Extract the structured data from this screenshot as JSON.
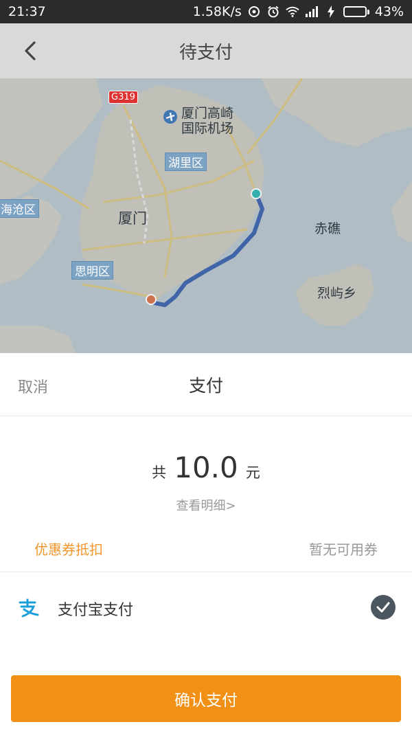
{
  "status_bar": {
    "time": "21:37",
    "network_speed": "1.58K/s",
    "battery_percent": "43%",
    "battery_level": 0.43,
    "icons": [
      "sync-icon",
      "alarm-icon",
      "wifi-icon",
      "signal-icon",
      "charging-icon",
      "battery-icon"
    ]
  },
  "header": {
    "title": "待支付",
    "back_icon": "chevron-left-icon"
  },
  "map": {
    "labels": {
      "road": "G319",
      "airport_1": "厦门高崎",
      "airport_2": "国际机场",
      "huli": "湖里区",
      "haicang": "海沧区",
      "xiamen": "厦门",
      "chijiao": "赤礁",
      "siming": "思明区",
      "lieyu": "烈屿乡"
    },
    "route_color": "#2f5aa8"
  },
  "sheet": {
    "cancel_label": "取消",
    "title": "支付",
    "amount_prefix": "共",
    "amount_value": "10.0",
    "amount_suffix": "元",
    "detail_link": "查看明细>",
    "coupon_label": "优惠券抵扣",
    "coupon_value": "暂无可用券",
    "payment_method": "支付宝支付",
    "confirm_label": "确认支付"
  },
  "colors": {
    "accent": "#f29016",
    "coupon_text": "#f0962d",
    "alipay": "#1aa0d8",
    "check_bg": "#4c5661"
  }
}
